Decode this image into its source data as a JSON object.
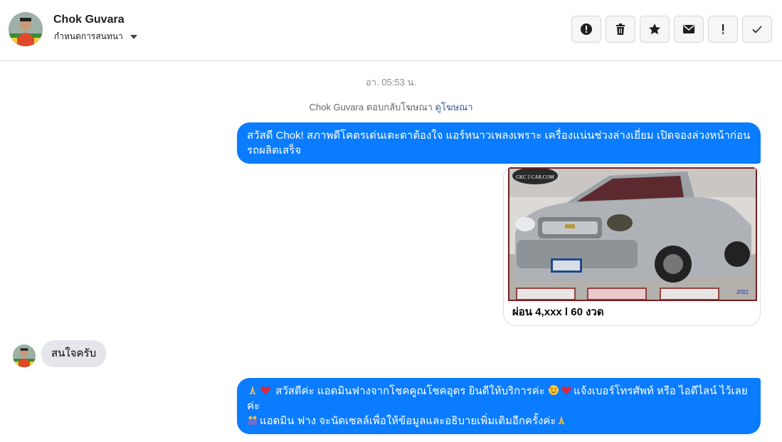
{
  "header": {
    "name": "Chok Guvara",
    "subtitle": "กำหนดการสนทนา",
    "actions": [
      "spam-icon",
      "trash-icon",
      "star-icon",
      "envelope-icon",
      "exclamation-icon",
      "check-icon"
    ]
  },
  "chat": {
    "timestamp": "อา. 05:53 น.",
    "reply_note": "Chok Guvara ตอบกลับโฆษณา",
    "reply_link": "ดูโฆษณา",
    "messages": [
      {
        "text": "สวัสดี Chok! สภาพดีโคตรเด่นเตะตาต้องใจ แอร์หนาวเพลงเพราะ เครื่องแน่นช่วงล่างเยี่ยม เปิดจองล่วงหน้าก่อนรถผลิตเสร็จ"
      },
      {
        "caption": "ผ่อน 4,xxx l 60 งวด",
        "watermark": "CKC 2 CAR.COM",
        "plate_code": "J092"
      },
      {
        "text": "สนใจครับ"
      },
      {
        "line1": "สวัสดีค่ะ แอดมินฟางจากโชคคูณโชคอุดร ยินดีให้บริการค่ะ",
        "line1b": "แจ้งเบอร์โทรศัพท์ หรือ ไอดีไลน์ ไว้เลยค่ะ",
        "line2": "แอดมิน ฟาง จะนัดเซลล์เพื่อให้ข้อมูลและอธิบายเพิ่มเติมอีกครั้งค่ะ"
      }
    ]
  },
  "colors": {
    "outgoing": "#0a7cff",
    "incoming": "#e4e6eb"
  }
}
